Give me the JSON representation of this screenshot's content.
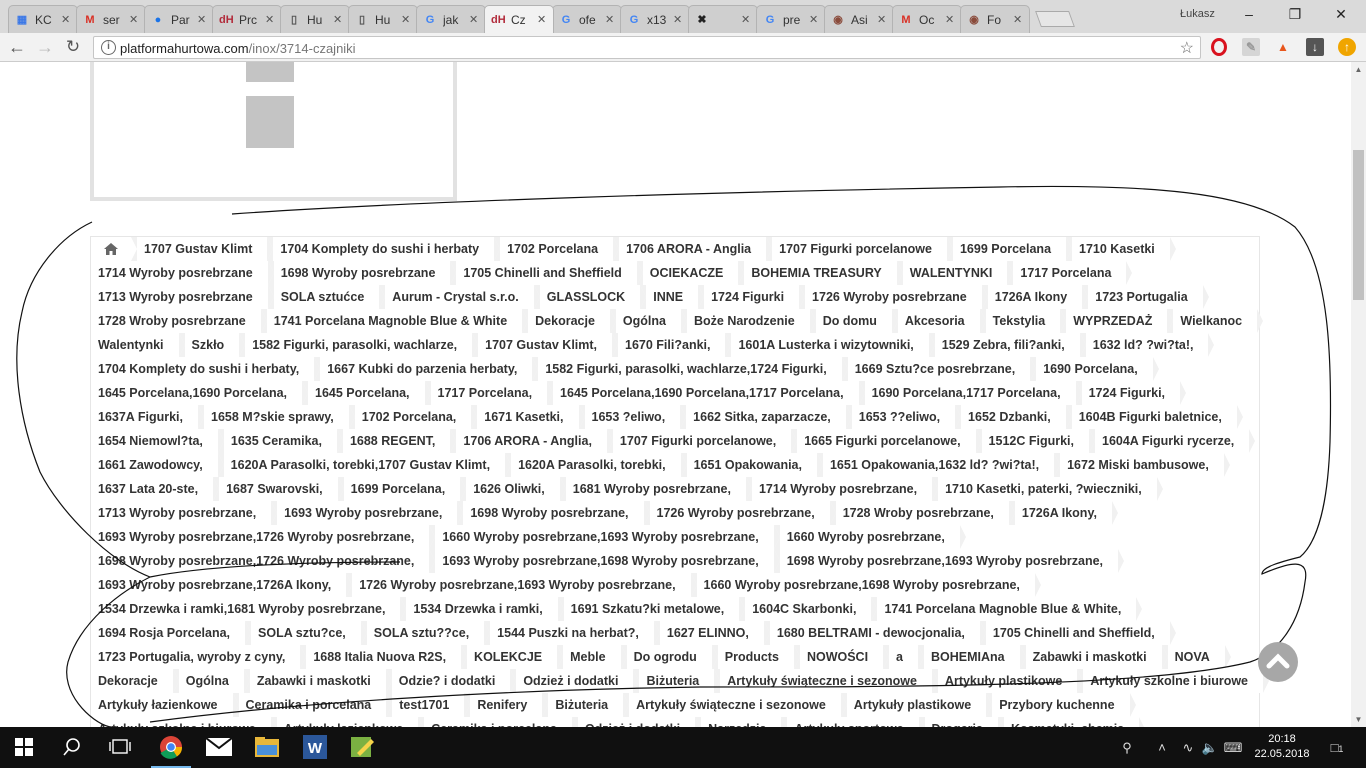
{
  "browser": {
    "tabs": [
      {
        "label": "KC",
        "icon": "grid-icon"
      },
      {
        "label": "ser",
        "icon": "gmail-icon"
      },
      {
        "label": "Par",
        "icon": "blue-circle-icon"
      },
      {
        "label": "Prc",
        "icon": "dh-icon"
      },
      {
        "label": "Hu",
        "icon": "document-icon"
      },
      {
        "label": "Hu",
        "icon": "document-icon"
      },
      {
        "label": "jak",
        "icon": "google-icon"
      },
      {
        "label": "Cz",
        "icon": "dh-icon",
        "active": true
      },
      {
        "label": "ofe",
        "icon": "google-icon"
      },
      {
        "label": "x13",
        "icon": "google-icon"
      },
      {
        "label": "",
        "icon": "xd-icon"
      },
      {
        "label": "pre",
        "icon": "google-icon"
      },
      {
        "label": "Asi",
        "icon": "avatar-icon"
      },
      {
        "label": "Oc",
        "icon": "gmail-icon"
      },
      {
        "label": "Fo",
        "icon": "avatar-icon"
      }
    ],
    "user_name": "Łukasz",
    "url_host": "platformahurtowa.com",
    "url_path": "/inox/3714-czajniki"
  },
  "breadcrumb_rows": [
    [
      "1707 Gustav Klimt",
      "1704 Komplety do sushi i herbaty",
      "1702 Porcelana",
      "1706 ARORA - Anglia",
      "1707 Figurki porcelanowe",
      "1699 Porcelana",
      "1710 Kasetki"
    ],
    [
      "1714 Wyroby posrebrzane",
      "1698 Wyroby posrebrzane",
      "1705 Chinelli and Sheffield",
      "OCIEKACZE",
      "BOHEMIA TREASURY",
      "WALENTYNKI",
      "1717 Porcelana"
    ],
    [
      "1713 Wyroby posrebrzane",
      "SOLA sztućce",
      "Aurum - Crystal s.r.o.",
      "GLASSLOCK",
      "INNE",
      "1724 Figurki",
      "1726 Wyroby posrebrzane",
      "1726A Ikony",
      "1723 Portugalia"
    ],
    [
      "1728 Wroby posrebrzane",
      "1741 Porcelana Magnoble Blue & White",
      "Dekoracje",
      "Ogólna",
      "Boże Narodzenie",
      "Do domu",
      "Akcesoria",
      "Tekstylia",
      "WYPRZEDAŻ",
      "Wielkanoc"
    ],
    [
      "Walentynki",
      "Szkło",
      "1582 Figurki, parasolki, wachlarze,",
      "1707 Gustav Klimt,",
      "1670 Fili?anki,",
      "1601A Lusterka i wizytowniki,",
      "1529 Zebra, fili?anki,",
      "1632 ld? ?wi?ta!,"
    ],
    [
      "1704 Komplety do sushi i herbaty,",
      "1667 Kubki do parzenia herbaty,",
      "1582 Figurki, parasolki, wachlarze,1724 Figurki,",
      "1669 Sztu?ce posrebrzane,",
      "1690 Porcelana,"
    ],
    [
      "1645 Porcelana,1690 Porcelana,",
      "1645 Porcelana,",
      "1717 Porcelana,",
      "1645 Porcelana,1690 Porcelana,1717 Porcelana,",
      "1690 Porcelana,1717 Porcelana,",
      "1724 Figurki,"
    ],
    [
      "1637A Figurki,",
      "1658 M?skie sprawy,",
      "1702 Porcelana,",
      "1671 Kasetki,",
      "1653 ?eliwo,",
      "1662 Sitka, zaparzacze,",
      "1653 ??eliwo,",
      "1652 Dzbanki,",
      "1604B Figurki baletnice,"
    ],
    [
      "1654 Niemowl?ta,",
      "1635 Ceramika,",
      "1688 REGENT,",
      "1706 ARORA - Anglia,",
      "1707 Figurki porcelanowe,",
      "1665 Figurki porcelanowe,",
      "1512C Figurki,",
      "1604A Figurki rycerze,"
    ],
    [
      "1661 Zawodowcy,",
      "1620A Parasolki, torebki,1707 Gustav Klimt,",
      "1620A Parasolki, torebki,",
      "1651 Opakowania,",
      "1651 Opakowania,1632 ld? ?wi?ta!,",
      "1672 Miski bambusowe,"
    ],
    [
      "1637 Lata 20-ste,",
      "1687 Swarovski,",
      "1699 Porcelana,",
      "1626 Oliwki,",
      "1681 Wyroby posrebrzane,",
      "1714 Wyroby posrebrzane,",
      "1710 Kasetki, paterki, ?wieczniki,"
    ],
    [
      "1713 Wyroby posrebrzane,",
      "1693 Wyroby posrebrzane,",
      "1698 Wyroby posrebrzane,",
      "1726 Wyroby posrebrzane,",
      "1728 Wroby posrebrzane,",
      "1726A Ikony,"
    ],
    [
      "1693 Wyroby posrebrzane,1726 Wyroby posrebrzane,",
      "1660 Wyroby posrebrzane,1693 Wyroby posrebrzane,",
      "1660 Wyroby posrebrzane,"
    ],
    [
      "1698 Wyroby posrebrzane,1726 Wyroby posrebrzane,",
      "1693 Wyroby posrebrzane,1698 Wyroby posrebrzane,",
      "1698 Wyroby posrebrzane,1693 Wyroby posrebrzane,"
    ],
    [
      "1693 Wyroby posrebrzane,1726A Ikony,",
      "1726 Wyroby posrebrzane,1693 Wyroby posrebrzane,",
      "1660 Wyroby posrebrzane,1698 Wyroby posrebrzane,"
    ],
    [
      "1534 Drzewka i ramki,1681 Wyroby posrebrzane,",
      "1534 Drzewka i ramki,",
      "1691 Szkatu?ki metalowe,",
      "1604C Skarbonki,",
      "1741 Porcelana Magnoble Blue & White,"
    ],
    [
      "1694 Rosja Porcelana,",
      "SOLA sztu?ce,",
      "SOLA sztu??ce,",
      "1544 Puszki na herbat?,",
      "1627 ELINNO,",
      "1680 BELTRAMI - dewocjonalia,",
      "1705 Chinelli and Sheffield,"
    ],
    [
      "1723 Portugalia, wyroby z cyny,",
      "1688 Italia Nuova R2S,",
      "KOLEKCJE",
      "Meble",
      "Do ogrodu",
      "Products",
      "NOWOŚCI",
      "a",
      "BOHEMIAna",
      "Zabawki i maskotki",
      "NOVA"
    ],
    [
      "Dekoracje",
      "Ogólna",
      "Zabawki i maskotki",
      "Odzie? i dodatki",
      "Odzież i dodatki",
      "Biżuteria",
      "Artykuły świąteczne i sezonowe",
      "Artykuły plastikowe",
      "Artykuły szkolne i biurowe"
    ],
    [
      "Artykuły łazienkowe",
      "Ceramika i porcelana",
      "test1701",
      "Renifery",
      "Biżuteria",
      "Artykuły świąteczne i sezonowe",
      "Artykuły plastikowe",
      "Przybory kuchenne"
    ],
    [
      "Artykuły szkolne i biurowe",
      "Artykuły łazienkowe",
      "Ceramika i porcelana",
      "Odzież i dodatki",
      "Narzędzia",
      "Artykuły sportowe",
      "Drogeria",
      "Kosmetyki, chemia"
    ]
  ],
  "taskbar": {
    "time": "20:18",
    "date": "22.05.2018",
    "notifications": "1"
  },
  "colors": {
    "page_bg": "#ffffff",
    "crumb_separator": "#f1f1f1",
    "taskbar_bg": "#101010"
  }
}
